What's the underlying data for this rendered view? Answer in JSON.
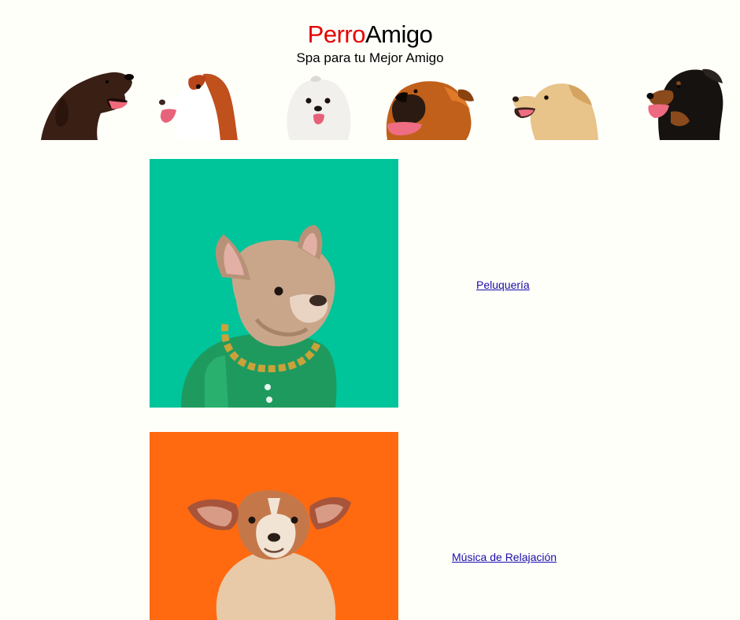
{
  "header": {
    "brand_part1": "Perro",
    "brand_part2": "Amigo",
    "tagline": "Spa para tu Mejor Amigo",
    "brand_color": "#e60000"
  },
  "banner": {
    "dogs": [
      "chocolate-labrador-icon",
      "springer-spaniel-icon",
      "maltese-icon",
      "boxer-icon",
      "golden-retriever-icon",
      "rottweiler-icon"
    ]
  },
  "services": [
    {
      "label": "Peluquería",
      "image": "french-bulldog-photo",
      "background": "#00c49a"
    },
    {
      "label": "Música de Relajación",
      "image": "corgi-photo",
      "background": "#ff6a10"
    }
  ]
}
